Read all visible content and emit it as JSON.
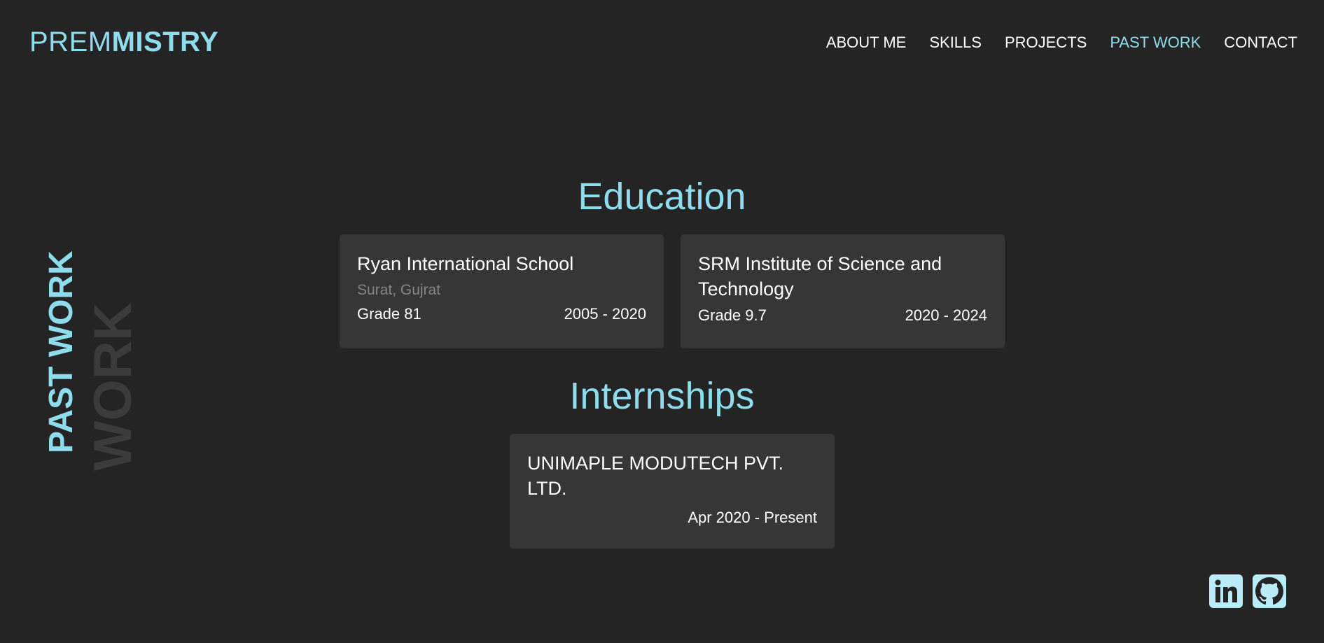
{
  "header": {
    "logo_first": "PREM",
    "logo_last": "MISTRY",
    "nav": [
      {
        "label": "ABOUT ME"
      },
      {
        "label": "SKILLS"
      },
      {
        "label": "PROJECTS"
      },
      {
        "label": "PAST WORK",
        "active": true
      },
      {
        "label": "CONTACT"
      }
    ]
  },
  "side": {
    "shadow_text": "WORK",
    "title": "PAST WORK"
  },
  "education": {
    "heading": "Education",
    "items": [
      {
        "name": "Ryan International School",
        "location": "Surat, Gujrat",
        "grade": "Grade 81",
        "years": "2005 - 2020"
      },
      {
        "name": "SRM Institute of Science and Technology",
        "grade": "Grade 9.7",
        "years": "2020 - 2024"
      }
    ]
  },
  "internships": {
    "heading": "Internships",
    "items": [
      {
        "company": "UNIMAPLE MODUTECH PVT. LTD.",
        "period": "Apr 2020 - Present"
      }
    ]
  },
  "social": [
    {
      "icon": "linkedin-icon"
    },
    {
      "icon": "github-icon"
    }
  ],
  "colors": {
    "background": "#242424",
    "accent": "#8fdcec",
    "card": "#363636",
    "muted_text": "#858585",
    "side_shadow": "#3b3b3b",
    "icon_bg": "#b9ecf6",
    "icon_fg": "#242424"
  }
}
